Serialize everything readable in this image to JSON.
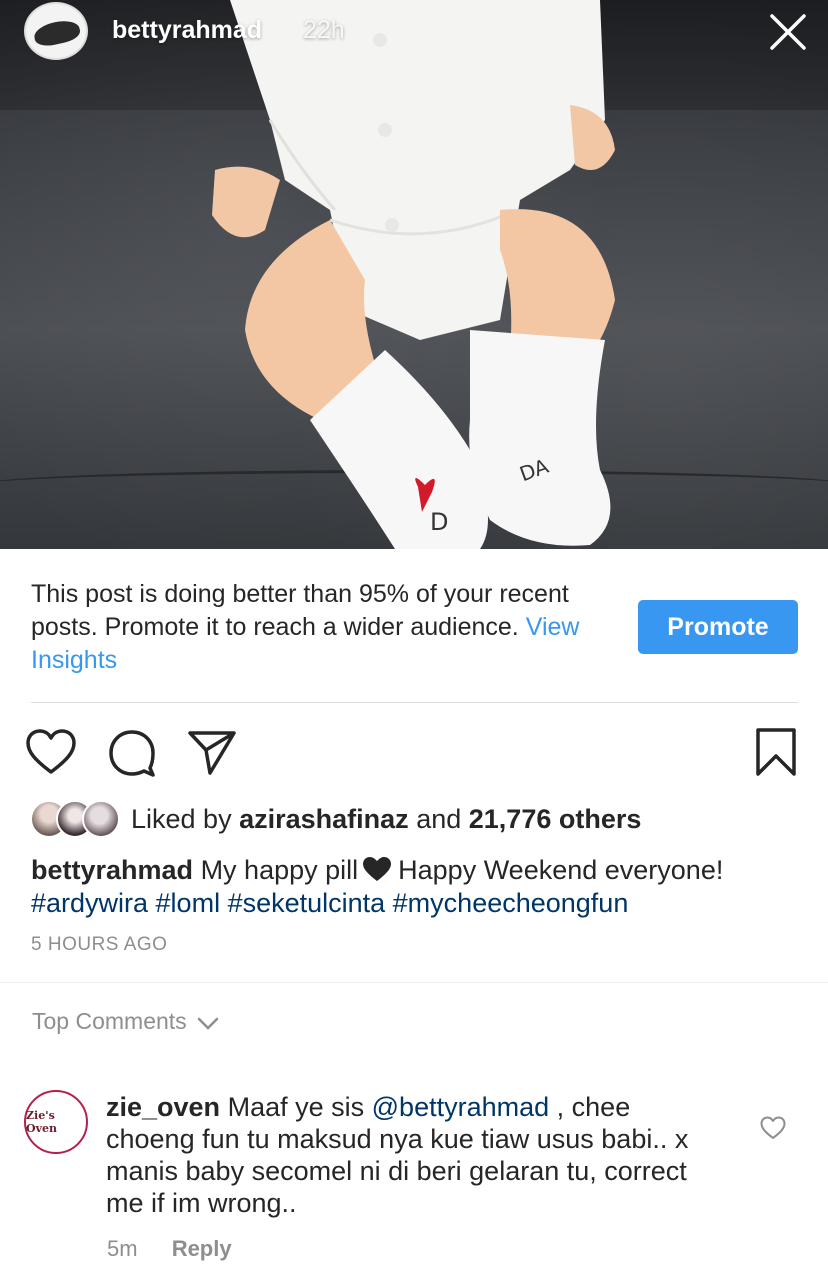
{
  "story": {
    "username": "bettyrahmad",
    "time": "22h"
  },
  "insights": {
    "message": "This post is doing better than 95% of your recent posts. Promote it to reach a wider audience.",
    "link": "View Insights",
    "promote_label": "Promote"
  },
  "likes": {
    "prefix": "Liked by",
    "user": "azirashafinaz",
    "and": "and",
    "count": "21,776 others"
  },
  "caption": {
    "user": "bettyrahmad",
    "text_before": "My happy pill",
    "text_after": "Happy Weekend everyone!",
    "hashtags": "#ardywira #loml #seketulcinta #mycheecheongfun"
  },
  "post_time": "5 HOURS AGO",
  "comments": {
    "header": "Top Comments",
    "items": [
      {
        "avatar_text": "Zie's Oven",
        "user": "zie_oven",
        "text_1": "Maaf ye sis",
        "mention": "@bettyrahmad",
        "text_2": ", chee choeng fun tu maksud nya kue tiaw usus babi.. x manis baby secomel ni di beri gelaran tu, correct me if im wrong..",
        "time": "5m",
        "reply": "Reply"
      }
    ]
  },
  "colors": {
    "accent": "#3897f0",
    "hashtag": "#003569",
    "muted": "#8e8e8e"
  }
}
